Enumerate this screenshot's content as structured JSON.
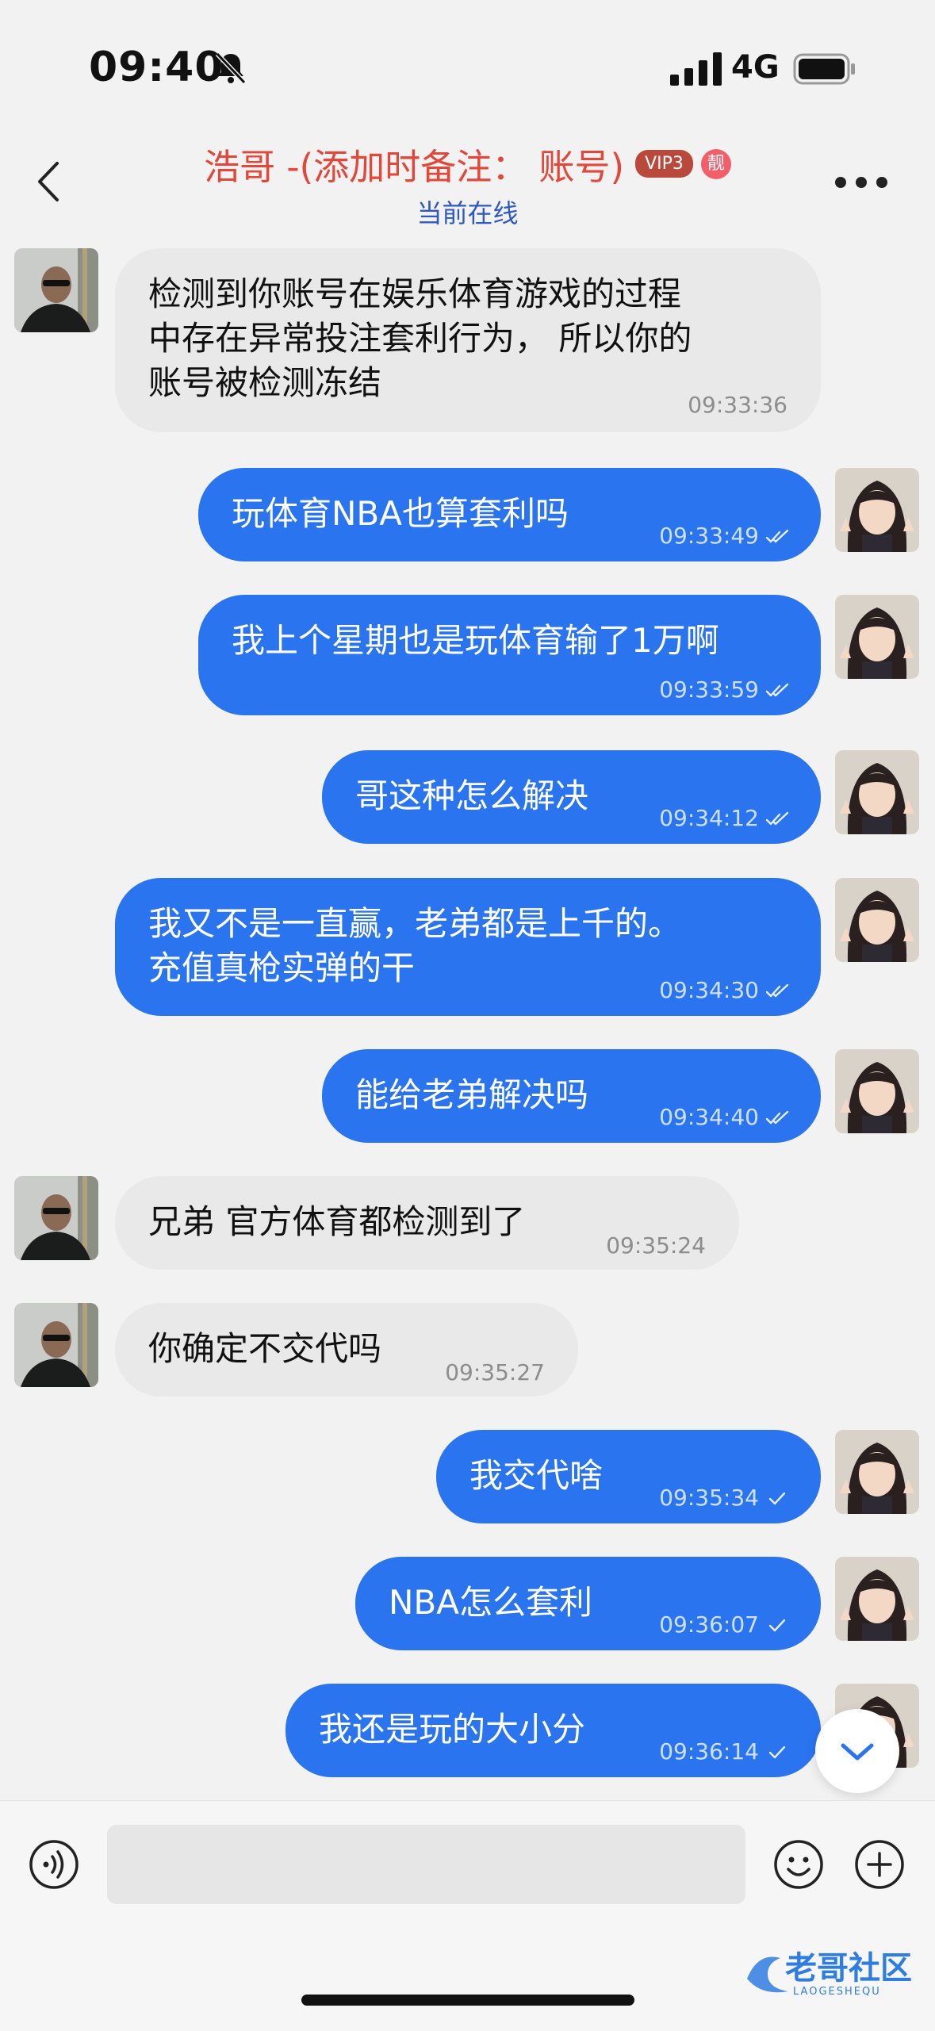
{
  "status_bar": {
    "time": "09:40",
    "network": "4G"
  },
  "header": {
    "contact_name": "浩哥 -(添加时备注： 账号)",
    "vip_badge": "VIP3",
    "liang_badge": "靓",
    "presence": "当前在线"
  },
  "messages": [
    {
      "dir": "in",
      "text": "检测到你账号在娱乐体育游戏的过程\n中存在异常投注套利行为， 所以你的\n账号被检测冻结",
      "time": "09:33:36"
    },
    {
      "dir": "out",
      "text": "玩体育NBA也算套利吗",
      "time": "09:33:49",
      "read": true
    },
    {
      "dir": "out",
      "text": "我上个星期也是玩体育输了1万啊",
      "time": "09:33:59",
      "read": true
    },
    {
      "dir": "out",
      "text": "哥这种怎么解决",
      "time": "09:34:12",
      "read": true
    },
    {
      "dir": "out",
      "text": "我又不是一直赢，老弟都是上千的。\n充值真枪实弹的干",
      "time": "09:34:30",
      "read": true
    },
    {
      "dir": "out",
      "text": "能给老弟解决吗",
      "time": "09:34:40",
      "read": true
    },
    {
      "dir": "in",
      "text": "兄弟 官方体育都检测到了",
      "time": "09:35:24"
    },
    {
      "dir": "in",
      "text": "你确定不交代吗",
      "time": "09:35:27"
    },
    {
      "dir": "out",
      "text": "我交代啥",
      "time": "09:35:34",
      "read": false
    },
    {
      "dir": "out",
      "text": "NBA怎么套利",
      "time": "09:36:07",
      "read": false
    },
    {
      "dir": "out",
      "text": "我还是玩的大小分",
      "time": "09:36:14",
      "read": false
    }
  ],
  "input": {
    "placeholder": ""
  },
  "watermark": {
    "main": "老哥社区",
    "sub": "LAOGESHEQU"
  },
  "colors": {
    "outgoing_bubble": "#2b74f0",
    "incoming_bubble": "#e9e9e9",
    "title": "#e2473a",
    "presence": "#2f58c4"
  }
}
